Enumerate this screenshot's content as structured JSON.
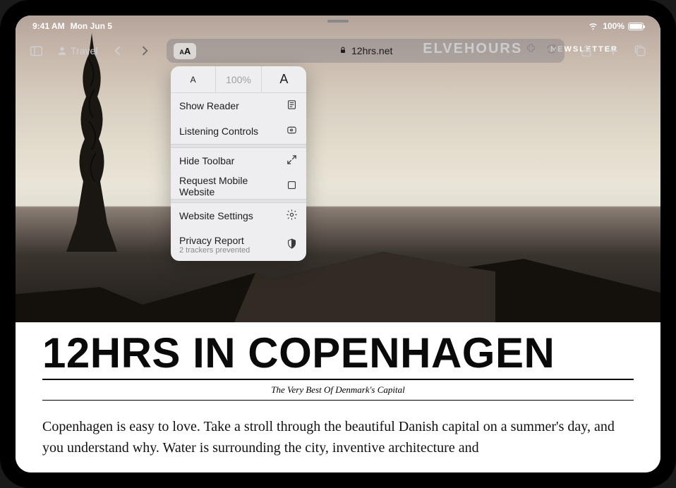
{
  "status": {
    "time": "9:41 AM",
    "date": "Mon Jun 5",
    "battery_pct": "100%"
  },
  "toolbar": {
    "profile_label": "Travel",
    "url_host": "12hrs.net"
  },
  "popover": {
    "zoom": "100%",
    "show_reader": "Show Reader",
    "listening_controls": "Listening Controls",
    "hide_toolbar": "Hide Toolbar",
    "request_mobile": "Request Mobile Website",
    "website_settings": "Website Settings",
    "privacy_report": "Privacy Report",
    "privacy_sub": "2 trackers prevented"
  },
  "page": {
    "brand": "ELVEHOURS",
    "newsletter": "NEWSLETTER",
    "headline": "12HRS IN COPENHAGEN",
    "subhead": "The Very Best Of Denmark's Capital",
    "body": "Copenhagen is easy to love. Take a stroll through the beautiful Danish capital on a summer's day, and you understand why. Water is surrounding the city, inventive architecture and"
  }
}
